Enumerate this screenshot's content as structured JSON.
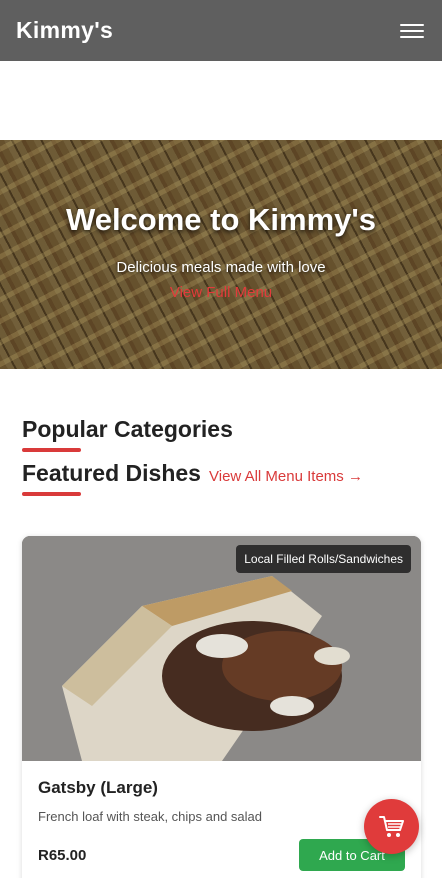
{
  "navbar": {
    "brand": "Kimmy's",
    "menu_icon": "hamburger-menu-icon"
  },
  "hero": {
    "title": "Welcome to Kimmy's",
    "subtitle": "Delicious meals made with love",
    "link": "View Full Menu"
  },
  "sections": {
    "categories_title": "Popular Categories",
    "featured_title": "Featured Dishes",
    "view_all": "View All Menu Items →"
  },
  "featured": [
    {
      "category": "Local Filled Rolls/Sandwiches",
      "name": "Gatsby (Large)",
      "description": "French loaf with steak, chips and salad",
      "price": "R65.00",
      "button": "Add to Cart"
    }
  ],
  "cart": {
    "icon": "shopping-cart-icon"
  },
  "colors": {
    "accent": "#d93a3a",
    "navbar": "#5f5f5f",
    "button_green": "#2fa84f"
  }
}
